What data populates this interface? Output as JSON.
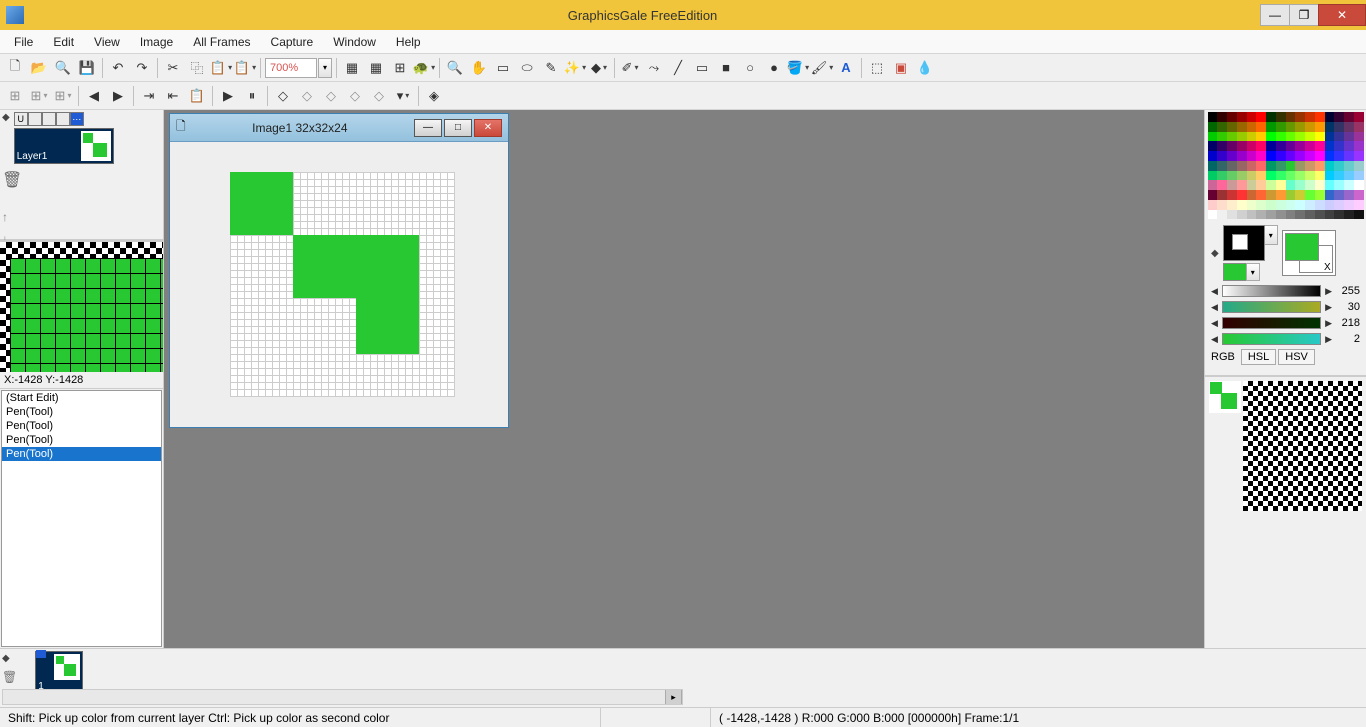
{
  "app": {
    "title": "GraphicsGale FreeEdition"
  },
  "menubar": [
    "File",
    "Edit",
    "View",
    "Image",
    "All Frames",
    "Capture",
    "Window",
    "Help"
  ],
  "toolbar1": {
    "zoom": "700%"
  },
  "document": {
    "title": "Image1 32x32x24"
  },
  "layers": {
    "layer1_label": "Layer1"
  },
  "coords": {
    "label": "X:-1428 Y:-1428"
  },
  "history": [
    "(Start Edit)",
    "Pen(Tool)",
    "Pen(Tool)",
    "Pen(Tool)",
    "Pen(Tool)"
  ],
  "color_sliders": {
    "lightness": 255,
    "c1": 30,
    "c2": 218,
    "c3": 2,
    "mode_label": "RGB",
    "tab_hsl": "HSL",
    "tab_hsv": "HSV",
    "swap_label": "X"
  },
  "frames": {
    "num": "1"
  },
  "status": {
    "hint": "Shift: Pick up color from current layer  Ctrl: Pick up color as second color",
    "info": "( -1428,-1428 )  R:000 G:000 B:000  [000000h]  Frame:1/1"
  },
  "palette_colors": [
    "#000000",
    "#330000",
    "#660000",
    "#990000",
    "#cc0000",
    "#ff0000",
    "#003300",
    "#333300",
    "#663300",
    "#993300",
    "#cc3300",
    "#ff3300",
    "#000033",
    "#330033",
    "#660033",
    "#990033",
    "#006600",
    "#336600",
    "#666600",
    "#996600",
    "#cc6600",
    "#ff6600",
    "#009900",
    "#339900",
    "#669900",
    "#999900",
    "#cc9900",
    "#ff9900",
    "#003366",
    "#333366",
    "#663366",
    "#993366",
    "#00cc00",
    "#33cc00",
    "#66cc00",
    "#99cc00",
    "#cccc00",
    "#ffcc00",
    "#00ff00",
    "#33ff00",
    "#66ff00",
    "#99ff00",
    "#ccff00",
    "#ffff00",
    "#003399",
    "#333399",
    "#663399",
    "#993399",
    "#000066",
    "#330066",
    "#660066",
    "#990066",
    "#cc0066",
    "#ff0066",
    "#000099",
    "#330099",
    "#660099",
    "#990099",
    "#cc0099",
    "#ff0099",
    "#0033cc",
    "#3333cc",
    "#6633cc",
    "#9933cc",
    "#0000cc",
    "#3300cc",
    "#6600cc",
    "#9900cc",
    "#cc00cc",
    "#ff00cc",
    "#0000ff",
    "#3300ff",
    "#6600ff",
    "#9900ff",
    "#cc00ff",
    "#ff00ff",
    "#0033ff",
    "#3333ff",
    "#6633ff",
    "#9933ff",
    "#006666",
    "#336666",
    "#666666",
    "#996666",
    "#cc6666",
    "#ff6666",
    "#009966",
    "#339966",
    "#28c832",
    "#999966",
    "#cc9966",
    "#ff9966",
    "#00cccc",
    "#33cccc",
    "#66cccc",
    "#99cccc",
    "#00cc66",
    "#33cc66",
    "#66cc66",
    "#99cc66",
    "#cccc66",
    "#ffcc66",
    "#00ff66",
    "#33ff66",
    "#66ff66",
    "#99ff66",
    "#ccff66",
    "#ffff66",
    "#00ccff",
    "#33ccff",
    "#66ccff",
    "#99ccff",
    "#cc6699",
    "#ff6699",
    "#cc9999",
    "#ff9999",
    "#cccc99",
    "#ffcc99",
    "#ccff99",
    "#ffff99",
    "#66ffcc",
    "#99ffcc",
    "#ccffcc",
    "#ffffcc",
    "#66ffff",
    "#99ffff",
    "#ccffff",
    "#ffffff",
    "#660033",
    "#993333",
    "#cc3333",
    "#ff3333",
    "#cc6633",
    "#ff6633",
    "#cc9933",
    "#ff9933",
    "#99cc33",
    "#cccc33",
    "#66ff33",
    "#99ff33",
    "#3366cc",
    "#6666cc",
    "#9966cc",
    "#cc66cc",
    "#ffcccc",
    "#ffddcc",
    "#ffeecc",
    "#ffffcc",
    "#eeffcc",
    "#ddffcc",
    "#ccffcc",
    "#ccffdd",
    "#ccffee",
    "#ccffff",
    "#cceeff",
    "#ccddff",
    "#ccccff",
    "#ddccff",
    "#eeccff",
    "#ffccff",
    "#ffffff",
    "#f0f0f0",
    "#e0e0e0",
    "#d0d0d0",
    "#c0c0c0",
    "#b0b0b0",
    "#a0a0a0",
    "#909090",
    "#808080",
    "#707070",
    "#606060",
    "#505050",
    "#404040",
    "#303030",
    "#202020",
    "#101010"
  ]
}
